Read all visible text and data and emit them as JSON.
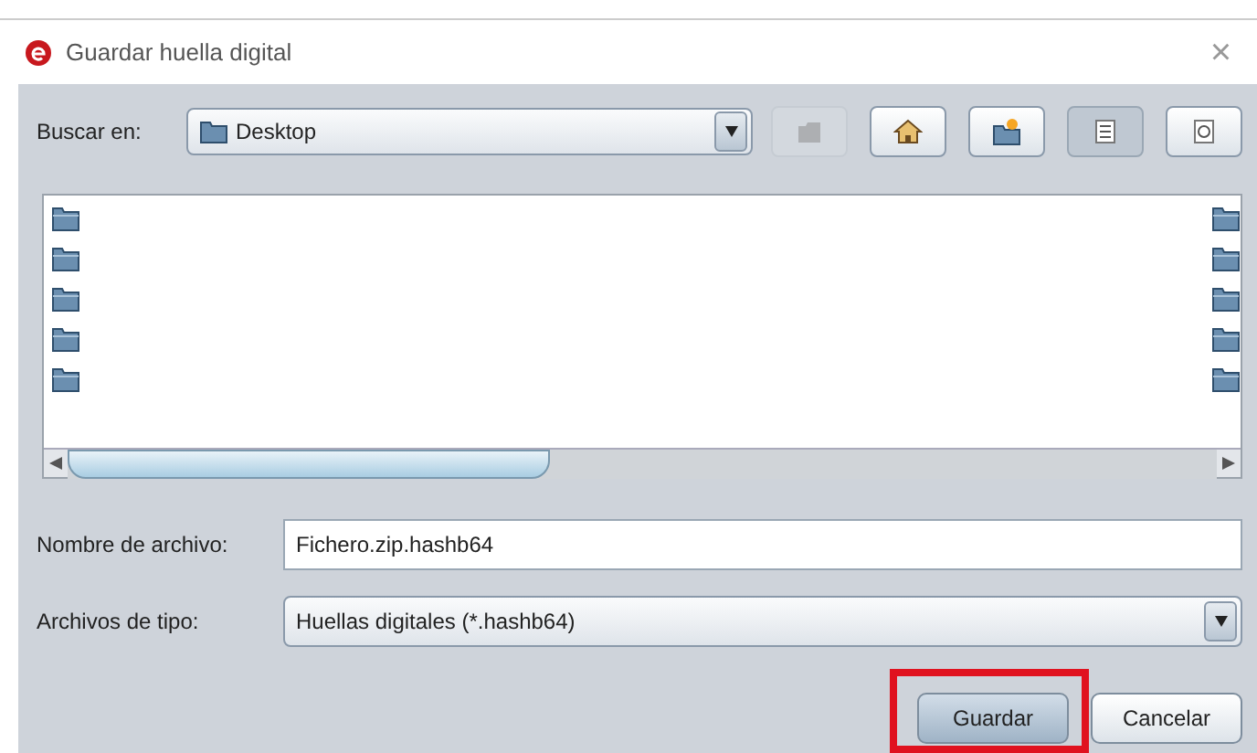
{
  "window": {
    "title": "Guardar huella digital",
    "close": "×"
  },
  "look_in": {
    "label": "Buscar en:",
    "value": "Desktop"
  },
  "toolbar": [
    {
      "kind": "up",
      "disabled": true,
      "selected": false
    },
    {
      "kind": "home",
      "disabled": false,
      "selected": false
    },
    {
      "kind": "newfolder",
      "disabled": false,
      "selected": false
    },
    {
      "kind": "list",
      "disabled": false,
      "selected": true
    },
    {
      "kind": "details",
      "disabled": false,
      "selected": false
    }
  ],
  "file_list": {
    "columns": [
      {
        "items": [
          {
            "kind": "folder"
          },
          {
            "kind": "folder"
          },
          {
            "kind": "folder"
          },
          {
            "kind": "folder"
          },
          {
            "kind": "folder"
          }
        ]
      },
      {
        "items": [
          {
            "kind": "folder"
          },
          {
            "kind": "folder"
          },
          {
            "kind": "folder"
          },
          {
            "kind": "folder"
          },
          {
            "kind": "folder"
          }
        ]
      }
    ]
  },
  "file_name": {
    "label": "Nombre de archivo:",
    "value": "Fichero.zip.hashb64"
  },
  "file_type": {
    "label": "Archivos de tipo:",
    "value": "Huellas digitales (*.hashb64)"
  },
  "buttons": [
    {
      "label": "Guardar",
      "highlighted": true
    },
    {
      "label": "Cancelar",
      "highlighted": false
    }
  ]
}
